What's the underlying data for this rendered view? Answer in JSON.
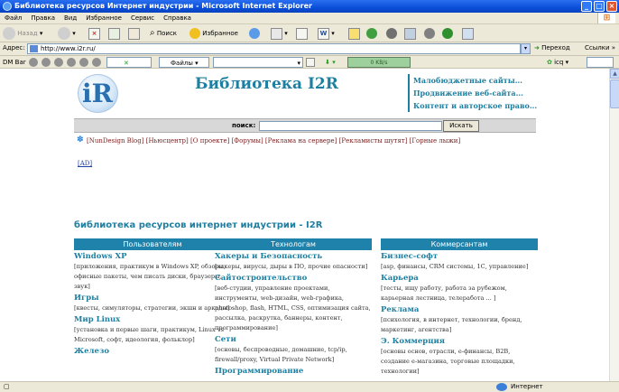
{
  "window": {
    "title": "Библиотека ресурсов Интернет индустрии - Microsoft Internet Explorer"
  },
  "menu": [
    "Файл",
    "Правка",
    "Вид",
    "Избранное",
    "Сервис",
    "Справка"
  ],
  "toolbar": {
    "back": "Назад",
    "search": "Поиск",
    "favorites": "Избранное"
  },
  "address": {
    "label": "Адрес:",
    "url": "http://www.i2r.ru/",
    "go": "Переход",
    "links": "Ссылки"
  },
  "dmbar": {
    "label": "DM Bar",
    "files": "Файлы",
    "speed": "0 KB/s",
    "icq": "icq"
  },
  "page": {
    "logo_text": "iR",
    "title": "Библиотека I2R",
    "promo": [
      "Малобюджетные сайты...",
      "Продвижение веб-сайта...",
      "Контент и авторское право..."
    ],
    "search_label": "поиск:",
    "search_button": "Искать",
    "nav": [
      "[NunDesign Blog]",
      "[Ньюсцентр]",
      "[О проекте]",
      "[Форумы]",
      "[Реклама на сервере]",
      "[Рекламисты шутят]",
      "[Горные лыжи]"
    ],
    "ad": "[AD]",
    "heading": "библиотека ресурсов интернет индустрии - I2R",
    "columns": [
      {
        "title": "Пользователям",
        "cats": [
          {
            "t": "Windows XP",
            "d": "[приложения, практикум в Windows XP, обзоры, офисные пакеты, чем писать диски, браузеры, звук]"
          },
          {
            "t": "Игры",
            "d": "[квесты, симуляторы, стратегии, экшн и аркады]"
          },
          {
            "t": "Мир Linux",
            "d": "[установка и первые шаги, практикум, Linux vs Microsoft, софт, идеология, фольклор]"
          },
          {
            "t": "Железо",
            "d": ""
          }
        ]
      },
      {
        "title": "Технологам",
        "cats": [
          {
            "t": "Хакеры и Безопасность",
            "d": "[хакеры, вирусы, дыры в ПО, прочие опасности]"
          },
          {
            "t": "Сайтостроительство",
            "d": "[веб-студии, управление проектами, инструменты, web-дизайн, web-графика, photoshop, flash, HTML, CSS, оптимизация сайта, рассылка, раскрутка, баннеры, контент, программирование]"
          },
          {
            "t": "Сети",
            "d": "[основы, беспроводные, домашние, tcp/ip, firewall/proxy, Virtual Private Network]"
          },
          {
            "t": "Программирование",
            "d": ""
          }
        ]
      },
      {
        "title": "Коммерсантам",
        "cats": [
          {
            "t": "Бизнес-софт",
            "d": "[asp, финансы, CRM системы, 1С, управление]"
          },
          {
            "t": "Карьера",
            "d": "[тесты, ищу работу, работа за рубежом, карьерная лестница, телеработа ... ]"
          },
          {
            "t": "Реклама",
            "d": "[психология, в интернет, технологии, бренд, маркетинг, агентства]"
          },
          {
            "t": "Э. Коммерция",
            "d": "[основы основ, отрасли, е-финансы, B2B, создание е-магазина, торговые площадки, технологии]"
          }
        ]
      }
    ]
  },
  "status": {
    "zone": "Интернет"
  }
}
